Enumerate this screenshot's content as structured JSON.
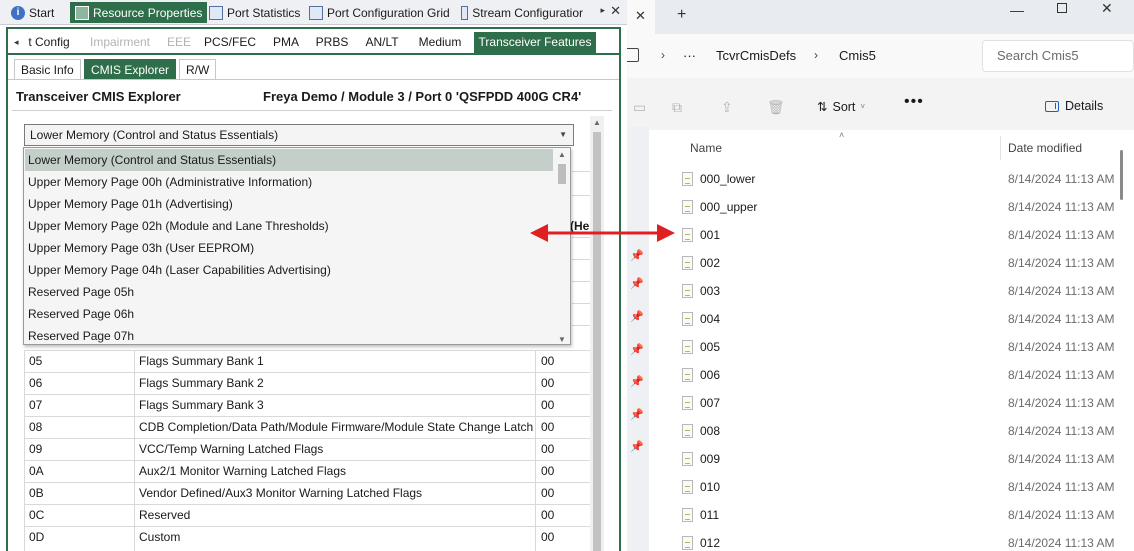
{
  "left_app": {
    "doc_tabs": [
      {
        "label": "Start",
        "icon": "info-icon"
      },
      {
        "label": "Resource Properties",
        "icon": "properties-icon"
      },
      {
        "label": "Port Statistics",
        "icon": "statistics-icon"
      },
      {
        "label": "Port Configuration Grid",
        "icon": "grid-icon"
      },
      {
        "label": "Stream Configuratior",
        "icon": "stream-icon"
      }
    ],
    "tab_scroll": "▸",
    "tab_close": "✕",
    "feature_tabs": {
      "scroll_left": "◂",
      "items": [
        "t Config",
        "Impairment",
        "EEE",
        "PCS/FEC",
        "PMA",
        "PRBS",
        "AN/LT",
        "Medium",
        "Transceiver Features"
      ]
    },
    "sub_tabs": [
      "Basic Info",
      "CMIS Explorer",
      "R/W"
    ],
    "panel_title": "Transceiver CMIS Explorer",
    "panel_module": "Freya Demo / Module 3 / Port 0 'QSFPDD 400G CR4'",
    "page_select": {
      "value": "Lower Memory (Control and Status Essentials)",
      "options": [
        "Lower Memory (Control and Status Essentials)",
        "Upper Memory Page 00h (Administrative Information)",
        "Upper Memory Page 01h (Advertising)",
        "Upper Memory Page 02h (Module and Lane Thresholds)",
        "Upper Memory Page 03h (User EEPROM)",
        "Upper Memory Page 04h (Laser Capabilities Advertising)",
        "Reserved Page 05h",
        "Reserved Page 06h",
        "Reserved Page 07h"
      ]
    },
    "hidden_column_header": "(He",
    "table_rows": [
      {
        "addr": "05",
        "name": "Flags Summary Bank 1",
        "value": "00"
      },
      {
        "addr": "06",
        "name": "Flags Summary Bank 2",
        "value": "00"
      },
      {
        "addr": "07",
        "name": "Flags Summary Bank 3",
        "value": "00"
      },
      {
        "addr": "08",
        "name": "CDB Completion/Data Path/Module Firmware/Module State Change Latch",
        "value": "00"
      },
      {
        "addr": "09",
        "name": "VCC/Temp Warning Latched Flags",
        "value": "00"
      },
      {
        "addr": "0A",
        "name": "Aux2/1 Monitor Warning Latched Flags",
        "value": "00"
      },
      {
        "addr": "0B",
        "name": "Vendor Defined/Aux3 Monitor Warning Latched Flags",
        "value": "00"
      },
      {
        "addr": "0C",
        "name": "Reserved",
        "value": "00"
      },
      {
        "addr": "0D",
        "name": "Custom",
        "value": "00"
      }
    ]
  },
  "right_app": {
    "new_tab": "+",
    "breadcrumb": [
      "TcvrCmisDefs",
      "Cmis5"
    ],
    "breadcrumb_more": "···",
    "search_placeholder": "Search Cmis5",
    "sort_label": "Sort",
    "more_label": "•••",
    "details_label": "Details",
    "columns": {
      "name": "Name",
      "date": "Date modified"
    },
    "files": [
      {
        "name": "000_lower",
        "date": "8/14/2024 11:13 AM"
      },
      {
        "name": "000_upper",
        "date": "8/14/2024 11:13 AM"
      },
      {
        "name": "001",
        "date": "8/14/2024 11:13 AM"
      },
      {
        "name": "002",
        "date": "8/14/2024 11:13 AM"
      },
      {
        "name": "003",
        "date": "8/14/2024 11:13 AM"
      },
      {
        "name": "004",
        "date": "8/14/2024 11:13 AM"
      },
      {
        "name": "005",
        "date": "8/14/2024 11:13 AM"
      },
      {
        "name": "006",
        "date": "8/14/2024 11:13 AM"
      },
      {
        "name": "007",
        "date": "8/14/2024 11:13 AM"
      },
      {
        "name": "008",
        "date": "8/14/2024 11:13 AM"
      },
      {
        "name": "009",
        "date": "8/14/2024 11:13 AM"
      },
      {
        "name": "010",
        "date": "8/14/2024 11:13 AM"
      },
      {
        "name": "011",
        "date": "8/14/2024 11:13 AM"
      },
      {
        "name": "012",
        "date": "8/14/2024 11:13 AM"
      }
    ]
  },
  "colors": {
    "accent_green": "#2e6e4a",
    "arrow_red": "#e02020",
    "selected_row": "#c3cfc8"
  }
}
